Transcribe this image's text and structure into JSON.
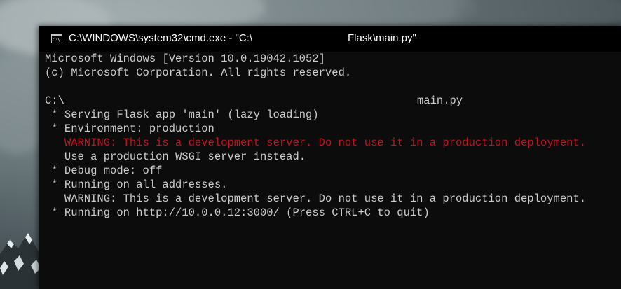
{
  "window": {
    "title_left": "C:\\WINDOWS\\system32\\cmd.exe - \"C:\\",
    "title_right": "Flask\\main.py\"",
    "icon": "cmd-icon"
  },
  "console": {
    "lines": [
      {
        "text": "Microsoft Windows [Version 10.0.19042.1052]",
        "color": "#cccccc"
      },
      {
        "text": "(c) Microsoft Corporation. All rights reserved.",
        "color": "#cccccc"
      },
      {
        "text": "",
        "color": "#cccccc"
      },
      {
        "text": "C:\\",
        "color": "#cccccc"
      },
      {
        "text": " * Serving Flask app 'main' (lazy loading)",
        "color": "#cccccc"
      },
      {
        "text": " * Environment: production",
        "color": "#cccccc"
      },
      {
        "text": "   WARNING: This is a development server. Do not use it in a production deployment.",
        "color": "#c50f1f"
      },
      {
        "text": "   Use a production WSGI server instead.",
        "color": "#cccccc"
      },
      {
        "text": " * Debug mode: off",
        "color": "#cccccc"
      },
      {
        "text": " * Running on all addresses.",
        "color": "#cccccc"
      },
      {
        "text": "   WARNING: This is a development server. Do not use it in a production deployment.",
        "color": "#cccccc"
      },
      {
        "text": " * Running on http://10.0.0.12:3000/ (Press CTRL+C to quit)",
        "color": "#cccccc"
      }
    ],
    "prompt_suffix": "main.py"
  }
}
